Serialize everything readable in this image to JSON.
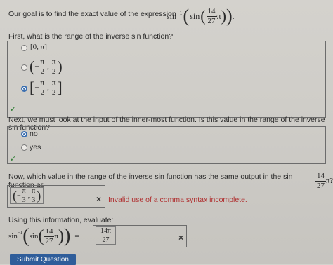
{
  "intro": {
    "text": "Our goal is to find the exact value of the expression",
    "expr": {
      "fn": "sin",
      "inv_exp": "−1",
      "inner": "sin",
      "num": "14",
      "den": "27",
      "sym": "π"
    }
  },
  "q1": {
    "prompt": "First, what is the range of the inverse sin function?",
    "options": [
      {
        "label": "[0, π]"
      },
      {
        "lparen": "(",
        "neg": "−",
        "num1": "π",
        "den1": "2",
        "sep": ",",
        "num2": "π",
        "den2": "2",
        "rparen": ")"
      },
      {
        "lparen": "[",
        "neg": "−",
        "num1": "π",
        "den1": "2",
        "sep": ",",
        "num2": "π",
        "den2": "2",
        "rparen": "]"
      }
    ],
    "selected_index": 2
  },
  "q2": {
    "prompt": "Next, we must look at the input of the inner-most function. Is this value in the range of the inverse sin function?",
    "options": [
      "no",
      "yes"
    ],
    "selected_index": 0
  },
  "q3": {
    "prompt": "Now, which value in the range of the inverse sin function has the same output in the sin function as",
    "frac_num": "14",
    "frac_den": "27",
    "suffix": "π?",
    "answer": {
      "lparen": "(",
      "neg": "−",
      "num1": "π",
      "den1": "3",
      "sep": ",",
      "num2": "π",
      "den2": "3",
      "rparen": ")"
    },
    "error": "Invalid use of a comma.syntax incomplete."
  },
  "q4": {
    "prompt": "Using this information, evaluate:",
    "expr": {
      "fn": "sin",
      "inv_exp": "−1",
      "inner": "sin",
      "num": "14",
      "den": "27",
      "sym": "π",
      "eq": "="
    },
    "answer": {
      "num": "14π",
      "den": "27"
    }
  },
  "submit_label": "Submit Question",
  "icons": {
    "check": "✓",
    "x": "×"
  }
}
